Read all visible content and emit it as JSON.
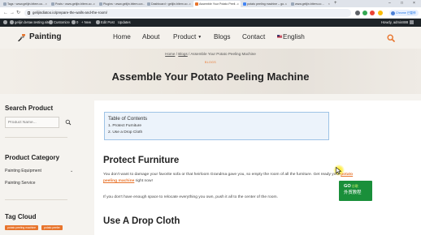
{
  "browser": {
    "tabs": [
      {
        "label": "Tags ‹ www.gelijin.bitem.co…",
        "active": false
      },
      {
        "label": "Posts ‹ www.gelijin.bitem.co…",
        "active": false
      },
      {
        "label": "Plugins ‹ www.gelijin.bitem.co…",
        "active": false
      },
      {
        "label": "Dashboard ‹ gelijin.bitem.co…",
        "active": false
      },
      {
        "label": "Assemble Your Potato Peeli…",
        "active": true
      },
      {
        "label": "potato peeling machine – go…",
        "active": false
      },
      {
        "label": "www.gelijin.bitem.co…",
        "active": false
      }
    ],
    "url": "gelijindiatoo.io/prepare-the-walls-and-the-room/",
    "profile_label": "Chrome 已暂停"
  },
  "adminbar": {
    "site": "gelijin.betae.testing.site",
    "customize": "Customize",
    "comments": "0",
    "new": "+ New",
    "edit_post": "Edit Post",
    "updates": "Updates",
    "howdy": "Howdy, admin888"
  },
  "header": {
    "logo": "Painting",
    "nav": [
      "Home",
      "About",
      "Product",
      "Blogs",
      "Contact",
      "English"
    ]
  },
  "hero": {
    "breadcrumb_home": "Home",
    "breadcrumb_sep1": " / ",
    "breadcrumb_blogs": "Blogs",
    "breadcrumb_sep2": " / ",
    "breadcrumb_current": "Assemble Your Potato Peeling Machine",
    "category": "BLOGS",
    "title": "Assemble Your Potato Peeling Machine"
  },
  "sidebar": {
    "search_title": "Search Product",
    "search_placeholder": "Product Name...",
    "category_title": "Product Category",
    "categories": [
      "Painting Equipment",
      "Painting Service"
    ],
    "tag_title": "Tag Cloud",
    "tags": [
      "potato peeling machine",
      "potato peeler"
    ]
  },
  "content": {
    "toc_title": "Table of Contents",
    "toc_items": [
      "1. Protect Furniture",
      "2. Use a Drop Cloth"
    ],
    "h2_1": "Protect Furniture",
    "p1_before": "You don't want to damage your favorite sofa or that heirloom Grandma gave you, so empty the room of all the furniture. Get ready your ",
    "p1_link": "potato",
    "p1_link2": "peeling machine",
    "p1_after": " right now!",
    "p2": "If you don't have enough space to relocate everything you own, push it all to the center of the room.",
    "h2_2": "Use A Drop Cloth"
  },
  "overlay": {
    "badge_top": "GO",
    "badge_top_small": "谷歌",
    "badge_bottom": "外贸教程"
  },
  "colors": {
    "accent": "#e8742c",
    "adminbar": "#1d2327",
    "badge": "#1a8f3a"
  }
}
